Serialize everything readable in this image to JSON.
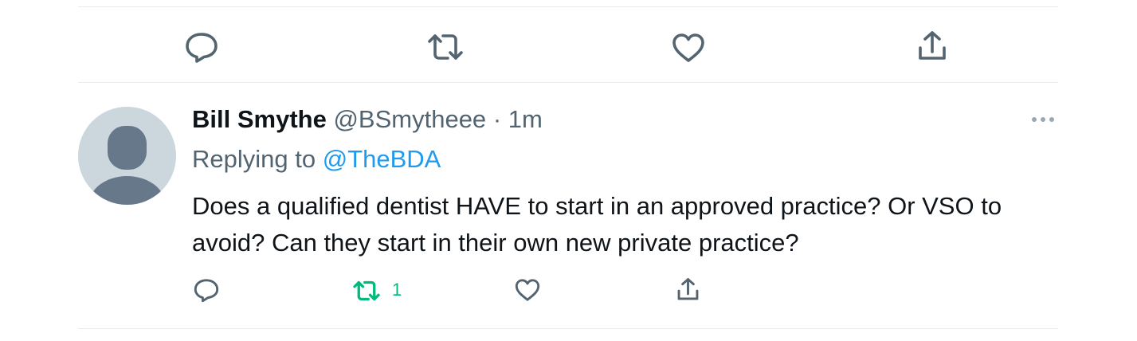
{
  "previous_tweet_actions": {
    "reply_icon": "reply-icon",
    "retweet_icon": "retweet-icon",
    "like_icon": "like-icon",
    "share_icon": "share-icon"
  },
  "tweet": {
    "display_name": "Bill Smythe",
    "handle": "@BSmytheee",
    "separator": "·",
    "time": "1m",
    "replying_prefix": "Replying to ",
    "replying_to": "@TheBDA",
    "text": "Does a qualified dentist HAVE to start in an approved practice? Or VSO to avoid? Can they start in their own new private practice?",
    "retweet_count": "1",
    "more_icon": "more-icon"
  },
  "colors": {
    "text_primary": "#0f1419",
    "text_secondary": "#536471",
    "link": "#1d9bf0",
    "retweet_active": "#00ba7c",
    "avatar_bg": "#ccd6dd",
    "avatar_figure": "#66788a",
    "divider": "#e6ecf0"
  }
}
